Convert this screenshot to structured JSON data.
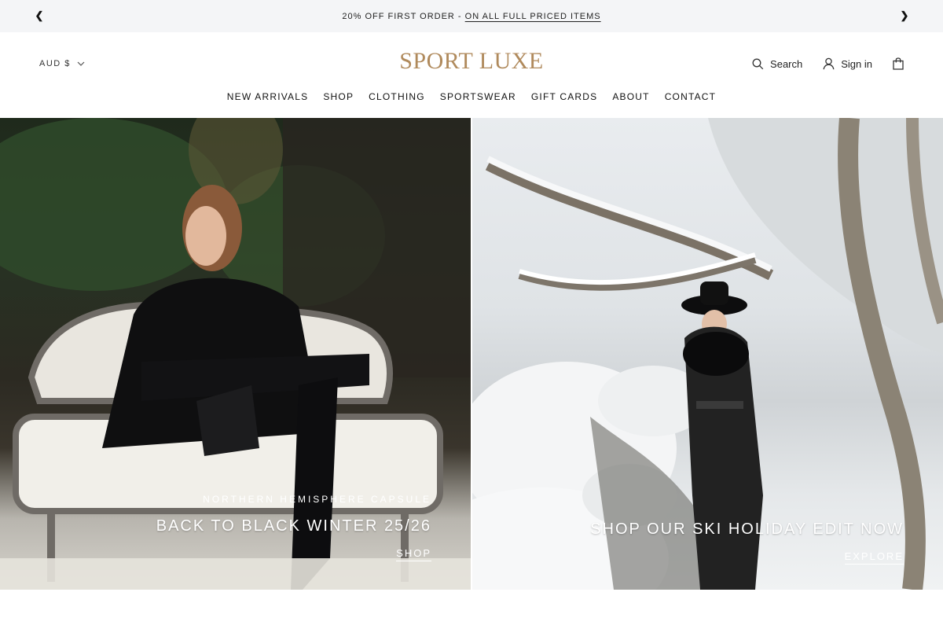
{
  "announcement": {
    "text": "20% OFF FIRST ORDER - ",
    "link": "ON ALL FULL PRICED ITEMS",
    "prev_icon": "chevron-left-icon",
    "next_icon": "chevron-right-icon"
  },
  "header": {
    "currency": "AUD $",
    "logo": "SPORT LUXE",
    "search_label": "Search",
    "signin_label": "Sign in",
    "cart_icon": "shopping-bag-icon"
  },
  "nav": {
    "items": [
      "NEW ARRIVALS",
      "SHOP",
      "CLOTHING",
      "SPORTSWEAR",
      "GIFT CARDS",
      "ABOUT",
      "CONTACT"
    ]
  },
  "hero": {
    "left": {
      "kicker": "NORTHERN HEMISPHERE CAPSULE",
      "headline": "BACK TO BLACK WINTER 25/26",
      "cta": "SHOP"
    },
    "right": {
      "headline": "SHOP OUR SKI HOLIDAY EDIT NOW",
      "cta": "EXPLORE"
    }
  },
  "colors": {
    "brand_gold": "#b08a5c",
    "announce_bg": "#f4f5f7"
  }
}
